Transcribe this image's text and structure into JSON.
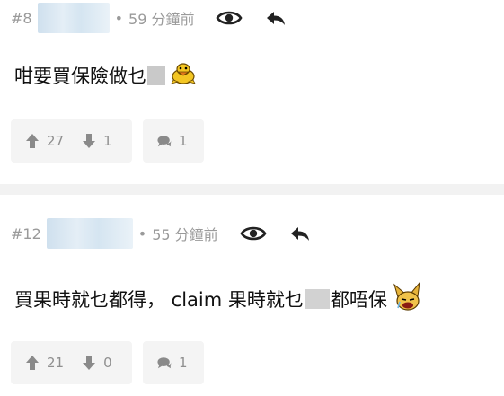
{
  "posts": [
    {
      "floor": "#8",
      "time": "59 分鐘前",
      "content_a": "咁要買保險做乜",
      "content_b": "",
      "upvotes": "27",
      "downvotes": "1",
      "comments": "1"
    },
    {
      "floor": "#12",
      "time": "55 分鐘前",
      "content_a": "買果時就乜都得， claim 果時就乜",
      "content_b": "都唔保",
      "upvotes": "21",
      "downvotes": "0",
      "comments": "1"
    }
  ],
  "separator_dot": "•",
  "icons": {
    "view": "eye-icon",
    "reply": "reply-icon",
    "upvote": "arrow-up-icon",
    "downvote": "arrow-down-icon",
    "comment": "comment-bubble-icon"
  },
  "colors": {
    "meta_text": "#9a9a9a",
    "button_bg": "#f4f4f4",
    "divider": "#f2f2f2"
  }
}
